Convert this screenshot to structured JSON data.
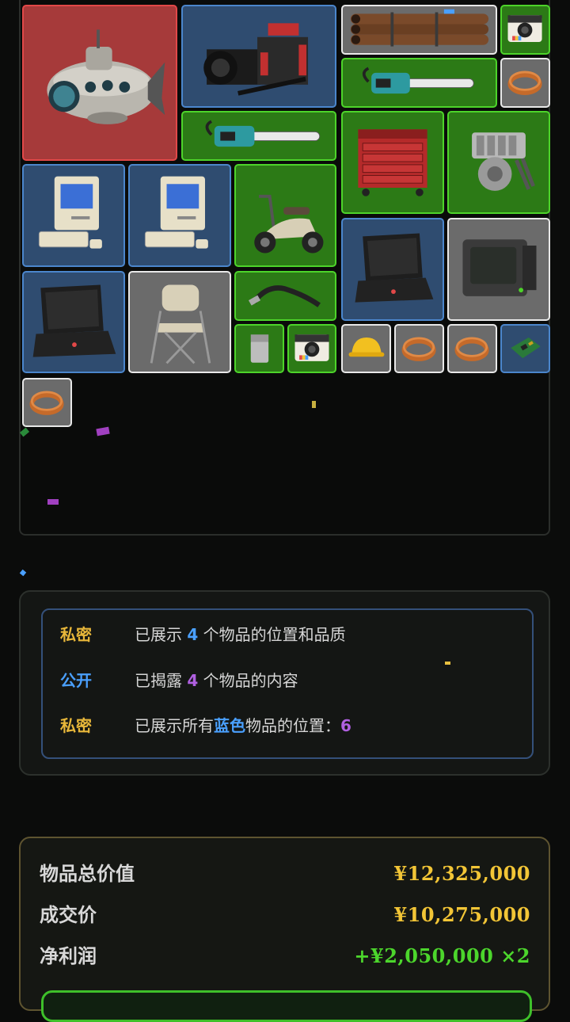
{
  "colors": {
    "red_quality": "#a63a3a",
    "blue_quality": "#2f4c70",
    "green_quality": "#2c7a16",
    "gray_quality": "#6b6b6b",
    "gold": "#f2c536",
    "profit_green": "#4cd62c"
  },
  "grid": {
    "items": [
      {
        "name": "submarine",
        "quality": "red"
      },
      {
        "name": "cinema-camera",
        "quality": "blue"
      },
      {
        "name": "pipe-bundle",
        "quality": "gray"
      },
      {
        "name": "instant-camera",
        "quality": "green"
      },
      {
        "name": "chainsaw",
        "quality": "green"
      },
      {
        "name": "copper-coil",
        "quality": "gray"
      },
      {
        "name": "chainsaw",
        "quality": "green"
      },
      {
        "name": "tool-chest",
        "quality": "green"
      },
      {
        "name": "engine-block",
        "quality": "green"
      },
      {
        "name": "retro-computer",
        "quality": "blue"
      },
      {
        "name": "retro-computer",
        "quality": "blue"
      },
      {
        "name": "scooter",
        "quality": "green"
      },
      {
        "name": "laptop",
        "quality": "blue"
      },
      {
        "name": "crt-monitor",
        "quality": "gray"
      },
      {
        "name": "laptop",
        "quality": "blue"
      },
      {
        "name": "folding-chair",
        "quality": "gray"
      },
      {
        "name": "welding-torch",
        "quality": "green"
      },
      {
        "name": "lighter",
        "quality": "green"
      },
      {
        "name": "instant-camera",
        "quality": "green"
      },
      {
        "name": "hard-hat",
        "quality": "gray"
      },
      {
        "name": "copper-coil",
        "quality": "gray"
      },
      {
        "name": "copper-coil",
        "quality": "gray"
      },
      {
        "name": "circuit-board",
        "quality": "blue"
      },
      {
        "name": "copper-coil",
        "quality": "gray"
      }
    ]
  },
  "clues": [
    {
      "tag": "私密",
      "before": "已展示 ",
      "num": "4",
      "after": " 个物品的位置和品质"
    },
    {
      "tag": "公开",
      "before": "已揭露 ",
      "num": "4",
      "after": " 个物品的内容"
    },
    {
      "tag": "私密",
      "before": "已展示所有",
      "highlight": "蓝色",
      "after": "物品的位置：",
      "num": "6"
    }
  ],
  "summary": {
    "total_label": "物品总价值",
    "total_value": "¥12,325,000",
    "deal_label": "成交价",
    "deal_value": "¥10,275,000",
    "profit_label": "净利润",
    "profit_value": "+¥2,050,000 ×2"
  }
}
